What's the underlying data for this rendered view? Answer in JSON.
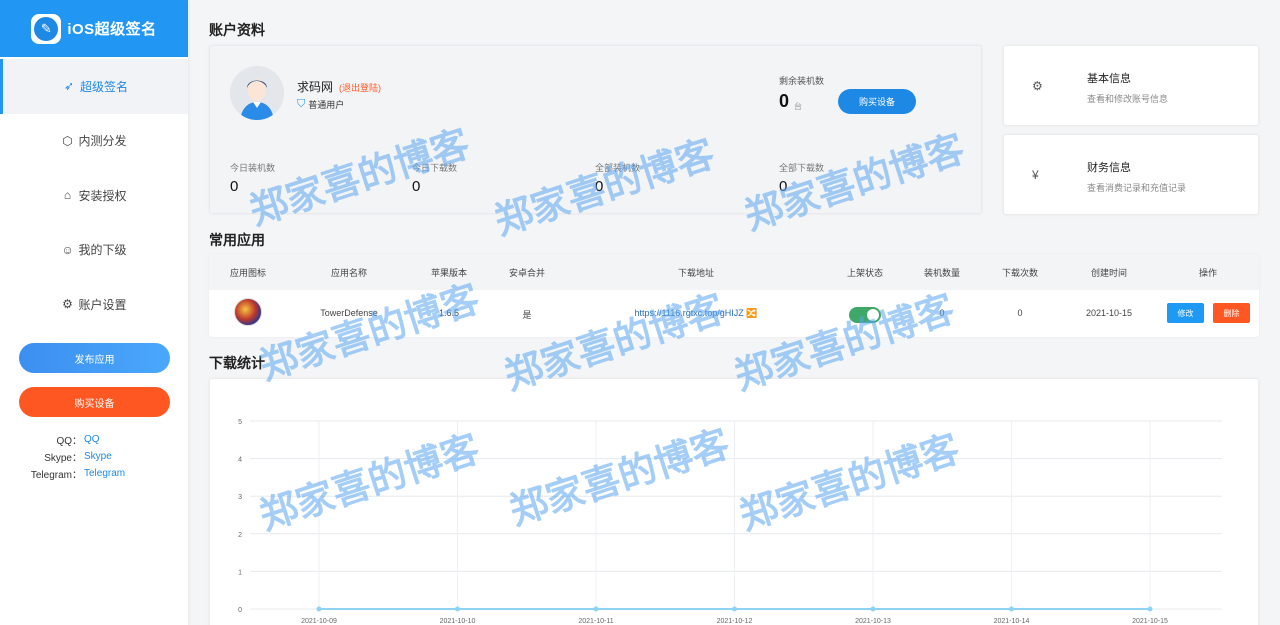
{
  "brand": {
    "title": "iOS超级签名",
    "icon": "pen-icon"
  },
  "sidebar": {
    "items": [
      {
        "label": "超级签名",
        "icon": "paper-plane-icon",
        "active": true
      },
      {
        "label": "内测分发",
        "icon": "cube-icon",
        "active": false
      },
      {
        "label": "安装授权",
        "icon": "tag-icon",
        "active": false
      },
      {
        "label": "我的下级",
        "icon": "user-icon",
        "active": false
      },
      {
        "label": "账户设置",
        "icon": "gear-icon",
        "active": false
      }
    ],
    "publish_label": "发布应用",
    "buy_label": "购买设备",
    "contacts": [
      {
        "label": "QQ：",
        "link": "QQ"
      },
      {
        "label": "Skype：",
        "link": "Skype"
      },
      {
        "label": "Telegram：",
        "link": "Telegram"
      }
    ]
  },
  "account": {
    "section_title": "账户资料",
    "username": "求码网",
    "logout_label": "(退出登陆)",
    "user_type": "普通用户",
    "remaining_label": "剩余装机数",
    "remaining_value": "0",
    "remaining_unit": "台",
    "buy_label": "购买设备",
    "stats": [
      {
        "label": "今日装机数",
        "value": "0"
      },
      {
        "label": "今日下载数",
        "value": "0"
      },
      {
        "label": "全部装机数",
        "value": "0"
      },
      {
        "label": "全部下载数",
        "value": "0"
      }
    ]
  },
  "info_cards": [
    {
      "title": "基本信息",
      "desc": "查看和修改账号信息",
      "icon": "gear-icon"
    },
    {
      "title": "财务信息",
      "desc": "查看消费记录和充值记录",
      "icon": "yen-icon"
    }
  ],
  "apps": {
    "section_title": "常用应用",
    "columns": [
      "应用图标",
      "应用名称",
      "苹果版本",
      "安卓合并",
      "下载地址",
      "上架状态",
      "装机数量",
      "下载次数",
      "创建时间",
      "操作"
    ],
    "rows": [
      {
        "name": "TowerDefense",
        "ios_version": "1.6.5",
        "android_merge": "是",
        "download_url": "https://1116.rgtxc.top/gHIJZ 🔀",
        "listed": true,
        "installs": "0",
        "downloads": "0",
        "created": "2021-10-15",
        "edit_label": "修改",
        "delete_label": "删除"
      }
    ]
  },
  "download_stats": {
    "section_title": "下载统计"
  },
  "chart_data": {
    "type": "line",
    "categories": [
      "2021-10-09",
      "2021-10-10",
      "2021-10-11",
      "2021-10-12",
      "2021-10-13",
      "2021-10-14",
      "2021-10-15"
    ],
    "series": [
      {
        "values": [
          0,
          0,
          0,
          0,
          0,
          0,
          0
        ],
        "color": "#8fd3f4"
      }
    ],
    "ylim": [
      0,
      5
    ],
    "yticks": [
      "0",
      "1",
      "2",
      "3",
      "4",
      "5"
    ],
    "grid": true
  },
  "watermark": "郑家喜的博客",
  "colors": {
    "primary": "#2196f3",
    "danger": "#ff5722",
    "success": "#3fa868"
  }
}
